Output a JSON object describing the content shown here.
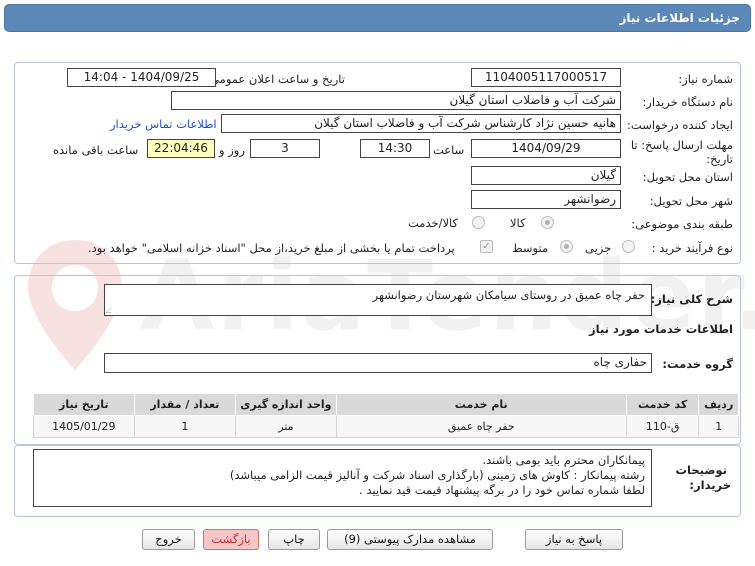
{
  "window": {
    "title": "جزئیات اطلاعات نیاز"
  },
  "watermark": {
    "text": "AriaTender.net"
  },
  "details": {
    "need_number_label": "شماره نیاز:",
    "need_number": "1104005117000517",
    "announce_label": "تاریخ و ساعت اعلان عمومی:",
    "announce_value": "1404/09/25 - 14:04",
    "buyer_org_label": "نام دستگاه خریدار:",
    "buyer_org": "شرکت آب و فاضلاب استان گیلان",
    "creator_label": "ایجاد کننده درخواست:",
    "creator": "هانیه حسین نژاد کارشناس شرکت آب و فاضلاب استان گیلان",
    "contact_link": "اطلاعات تماس خریدار",
    "deadline_label_1": "مهلت ارسال پاسخ: تا",
    "deadline_label_2": "تاریخ:",
    "deadline_date": "1404/09/29",
    "time_label": "ساعت",
    "deadline_time": "14:30",
    "days_value": "3",
    "days_label": "روز و",
    "remaining_time": "22:04:46",
    "remaining_label": "ساعت باقی مانده",
    "province_label": "استان محل تحویل:",
    "province": "گیلان",
    "city_label": "شهر محل تحویل:",
    "city": "رضوانشهر",
    "category_label": "طبقه بندی موضوعی:",
    "category_options": [
      "کالا",
      "کالا/خدمت"
    ],
    "category_selected": "کالا/خدمت",
    "process_label": "نوع فرآیند خرید :",
    "process_options": [
      "جزیی",
      "متوسط"
    ],
    "process_selected": "متوسط",
    "payment_note": "پرداخت تمام یا بخشی از مبلغ خرید،از محل \"اسناد خزانه اسلامی\" خواهد بود."
  },
  "summary": {
    "label": "شرح کلی نیاز:",
    "value": "حفر چاه عمیق در روستای سیامکان شهرستان رضوانشهر"
  },
  "services": {
    "section_title": "اطلاعات خدمات مورد نیاز",
    "group_label": "گروه خدمت:",
    "group_value": "حفاری چاه",
    "columns": [
      "ردیف",
      "کد خدمت",
      "نام خدمت",
      "واحد اندازه گیری",
      "تعداد / مقدار",
      "تاریخ نیاز"
    ],
    "rows": [
      {
        "row": "1",
        "code": "ق-110",
        "name": "حفر چاه عمیق",
        "unit": "متر",
        "qty": "1",
        "date": "1405/01/29"
      }
    ]
  },
  "buyer_notes": {
    "label_1": "توضیحات",
    "label_2": "خریدار:",
    "lines": [
      "پیمانکاران محترم باید بومی باشند.",
      "رشته پیمانکار :   کاوش های زمینی  (بارگذاری اسناد شرکت و آنالیز قیمت  الزامی میباشد)",
      "لطفا شماره تماس خود را در برگه پیشنهاد قیمت قید نمایید ."
    ]
  },
  "buttons": {
    "reply": "پاسخ به نیاز",
    "docs": "مشاهده مدارک پیوستی (9)",
    "print": "چاپ",
    "back": "بازگشت",
    "exit": "خروج"
  }
}
